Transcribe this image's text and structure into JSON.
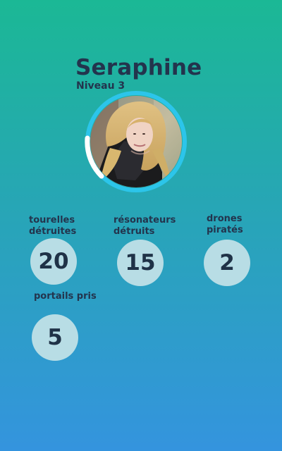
{
  "player": {
    "name": "Seraphine",
    "level": "Niveau 3"
  },
  "colors": {
    "background_top": "#1bb895",
    "background_bottom": "#3494de",
    "text": "#23344d",
    "stat_circle": "#b8dde5",
    "avatar_ring": "#21bbe9"
  },
  "stats": [
    {
      "label": "tourelles détruites",
      "value": "20"
    },
    {
      "label": "résonateurs détruits",
      "value": "15"
    },
    {
      "label": "drones piratés",
      "value": "2"
    },
    {
      "label": "portails pris",
      "value": "5"
    }
  ]
}
